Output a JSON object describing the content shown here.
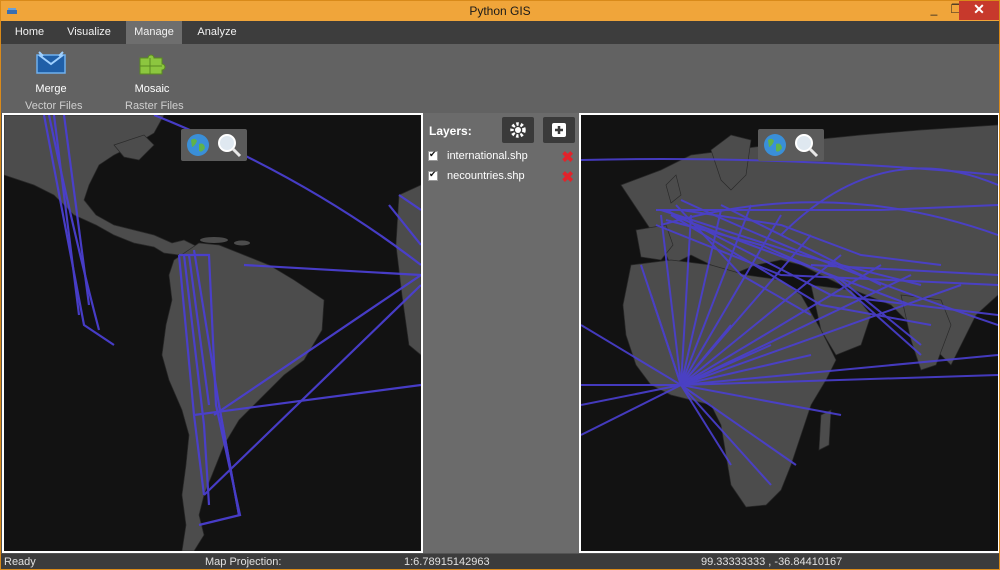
{
  "window": {
    "title": "Python GIS",
    "minimize": "_",
    "maximize": "❐",
    "close": "✕"
  },
  "tabs": [
    {
      "label": "Home"
    },
    {
      "label": "Visualize"
    },
    {
      "label": "Manage"
    },
    {
      "label": "Analyze"
    }
  ],
  "active_tab": "Manage",
  "ribbon": {
    "buttons": [
      {
        "label": "Merge",
        "icon": "merge-icon"
      },
      {
        "label": "Mosaic",
        "icon": "mosaic-icon"
      }
    ],
    "groups": [
      "Vector Files",
      "Raster Files"
    ]
  },
  "layers_panel": {
    "title": "Layers:",
    "settings_icon": "gear-icon",
    "add_icon": "plus-icon",
    "layers": [
      {
        "name": "international.shp",
        "checked": true
      },
      {
        "name": "necountries.shp",
        "checked": true
      }
    ]
  },
  "map_controls": {
    "globe_icon": "globe-icon",
    "zoom_icon": "magnifier-icon"
  },
  "colors": {
    "route": "#4a3fd0",
    "land": "#4c4c4c",
    "sea": "#121212",
    "accent": "#f0a53a"
  },
  "status": {
    "state": "Ready",
    "projection_label": "Map Projection:",
    "scale": "1:6.78915142963",
    "coords": "99.33333333 , -36.84410167"
  }
}
